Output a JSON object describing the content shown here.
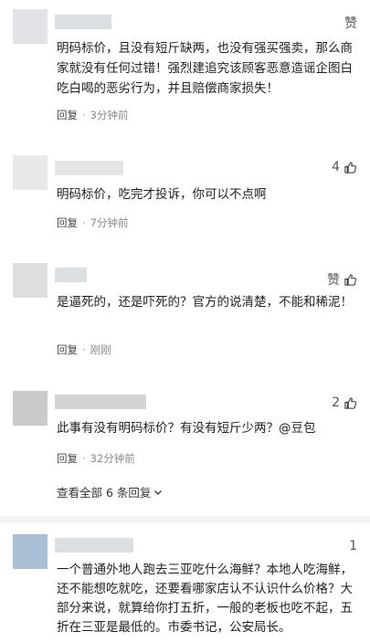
{
  "comments": [
    {
      "like_label": "赞",
      "like_count": "",
      "text": "明码标价，且没有短斤缺两，也没有强买强卖，那么商家就没有任何过错！强烈建追究该顾客恶意造谣企图白吃白喝的恶劣行为，并且赔偿商家损失！",
      "reply": "回复",
      "time": "3分钟前"
    },
    {
      "like_label": "",
      "like_count": "4",
      "text": "明码标价，吃完才投诉，你可以不点啊",
      "reply": "回复",
      "time": "7分钟前"
    },
    {
      "like_label": "赞",
      "like_count": "",
      "text": "是逼死的，还是吓死的？官方的说清楚，不能和稀泥！",
      "reply": "回复",
      "time": "刚刚"
    },
    {
      "like_label": "",
      "like_count": "2",
      "text": "此事有没有明码标价？有没有短斤少两？@豆包",
      "reply": "回复",
      "time": "32分钟前"
    }
  ],
  "view_all": {
    "label": "查看全部 6 条回复"
  },
  "last_comment": {
    "like_count": "1",
    "text": "一个普通外地人跑去三亚吃什么海鲜？本地人吃海鲜，还不能想吃就吃，还要看哪家店认不认识什么价格？大部分来说，就算给你打五折，一般的老板也吃不起，五折在三亚是最低的。市委书记，公安局长。"
  }
}
